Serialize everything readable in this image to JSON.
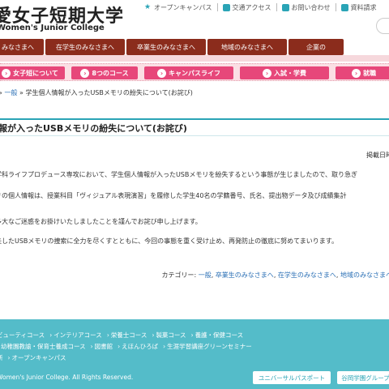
{
  "header": {
    "logo_jp": "愛女子短期大学",
    "logo_en": "Women's Junior College",
    "util_links": [
      {
        "label": "オープンキャンパス",
        "icon": "star-icon"
      },
      {
        "label": "交通アクセス",
        "icon": "train-icon"
      },
      {
        "label": "お問い合わせ",
        "icon": "phone-icon"
      },
      {
        "label": "資料請求",
        "icon": "document-icon"
      }
    ]
  },
  "mainnav": [
    {
      "label": "みなさまへ"
    },
    {
      "label": "在学生のみなさまへ"
    },
    {
      "label": "卒業生のみなさまへ"
    },
    {
      "label": "地域のみなさまへ"
    },
    {
      "label": "企業の"
    }
  ],
  "subnav": [
    {
      "label": "女子短について"
    },
    {
      "label": "8つのコース"
    },
    {
      "label": "キャンパスライフ"
    },
    {
      "label": "入試・学費"
    },
    {
      "label": "就職"
    }
  ],
  "breadcrumb": {
    "prefix": "»",
    "link": "一般",
    "sep": "»",
    "current": "学生個人情報が入ったUSBメモリの紛失について(お詫び)"
  },
  "article": {
    "title": "報が入ったUSBメモリの紛失について(お詫び)",
    "date_label": "掲載日時",
    "paragraphs": [
      "学科ライフプロデュース専攻において、学生個人情報が入ったUSBメモリを紛失するという事態が生じましたので、取り急ぎ",
      "リの個人情報は、授業科目「ヴィジュアル表現演習」を履修した学生40名の学籍番号、氏名、提出物データ及び成績集計",
      "多大なご迷惑をお掛けいたしましたことを謹んでお詫び申し上げます。",
      "失したUSBメモリの捜索に全力を尽くすとともに、今回の事態を重く受け止め、再発防止の徹底に努めてまいります。"
    ],
    "category_label": "カテゴリー:",
    "categories": [
      "一般",
      "卒業生のみなさまへ",
      "在学生のみなさまへ",
      "地域のみなさまへ"
    ]
  },
  "footer": {
    "row1": [
      "ビューティコース",
      "インテリアコース",
      "栄養士コース",
      "製菓コース",
      "養護・保健コース"
    ],
    "row2": [
      "幼稚園教諭・保育士養成コース",
      "図書館",
      "えほんひろば",
      "生涯学習講座グリーンセミナー"
    ],
    "row3": [
      "所",
      "オープンキャンパス"
    ],
    "copyright": "Women's Junior College. All Rights Reserved.",
    "buttons": [
      "ユニバーサルパスポート",
      "谷岡学園グループ"
    ]
  },
  "colors": {
    "nav_brown": "#8b2c1c",
    "pink_accent": "#e7477a",
    "teal": "#2aa4b6",
    "footer_teal": "#54bcc9",
    "link_blue": "#2a6fb5"
  }
}
